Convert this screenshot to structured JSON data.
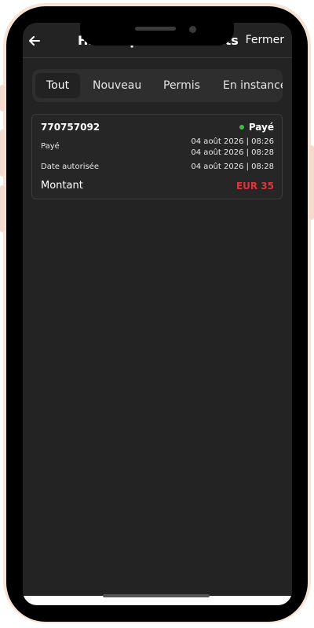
{
  "header": {
    "title": "Historique des retraits",
    "close_label": "Fermer",
    "back_icon": "arrow-left-icon"
  },
  "tabs": [
    {
      "label": "Tout",
      "active": true
    },
    {
      "label": "Nouveau",
      "active": false
    },
    {
      "label": "Permis",
      "active": false
    },
    {
      "label": "En instance",
      "active": false
    }
  ],
  "withdrawals": [
    {
      "id": "770757092",
      "status": "Payé",
      "status_color": "#3fbf3f",
      "paid_label": "Payé",
      "paid_date_1": "04 août 2026 | 08:26",
      "paid_date_2": "04 août 2026 | 08:28",
      "authorized_label": "Date autorisée",
      "authorized_date": "04 août 2026 | 08:28",
      "amount_label": "Montant",
      "amount": "EUR 35",
      "amount_color": "#e8313a"
    }
  ]
}
